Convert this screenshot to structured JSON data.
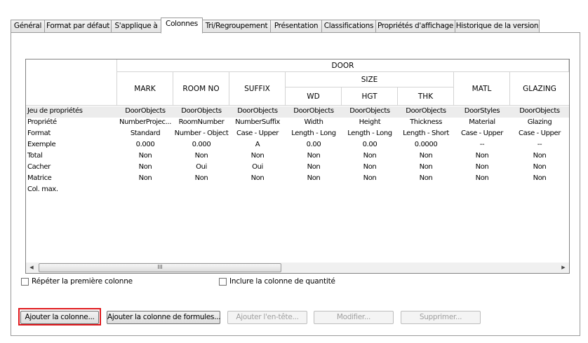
{
  "tabs": [
    {
      "label": "Général"
    },
    {
      "label": "Format par défaut"
    },
    {
      "label": "S'applique à"
    },
    {
      "label": "Colonnes"
    },
    {
      "label": "Tri/Regroupement"
    },
    {
      "label": "Présentation"
    },
    {
      "label": "Classifications"
    },
    {
      "label": "Propriétés d'affichage"
    },
    {
      "label": "Historique de la version"
    }
  ],
  "active_tab": "Colonnes",
  "grid": {
    "group_header": "DOOR",
    "size_header": "SIZE",
    "columns": [
      "MARK",
      "ROOM NO",
      "SUFFIX",
      "WD",
      "HGT",
      "THK",
      "MATL",
      "GLAZING"
    ],
    "row_labels": [
      "Jeu de propriétés",
      "Propriété",
      "Format",
      "Exemple",
      "Total",
      "Cacher",
      "Matrice",
      "Col. max."
    ],
    "rows": [
      [
        "DoorObjects",
        "DoorObjects",
        "DoorObjects",
        "DoorObjects",
        "DoorObjects",
        "DoorObjects",
        "DoorStyles",
        "DoorObjects"
      ],
      [
        "NumberProjec...",
        "RoomNumber",
        "NumberSuffix",
        "Width",
        "Height",
        "Thickness",
        "Material",
        "Glazing"
      ],
      [
        "Standard",
        "Number - Object",
        "Case - Upper",
        "Length - Long",
        "Length - Long",
        "Length - Short",
        "Case - Upper",
        "Case - Upper"
      ],
      [
        "0.000",
        "0.000",
        "A",
        "0.00",
        "0.00",
        "0.0000",
        "--",
        "--"
      ],
      [
        "Non",
        "Non",
        "Non",
        "Non",
        "Non",
        "Non",
        "Non",
        "Non"
      ],
      [
        "Non",
        "Oui",
        "Oui",
        "Non",
        "Non",
        "Non",
        "Non",
        "Non"
      ],
      [
        "Non",
        "Non",
        "Non",
        "Non",
        "Non",
        "Non",
        "Non",
        "Non"
      ],
      [
        "",
        "",
        "",
        "",
        "",
        "",
        "",
        ""
      ]
    ]
  },
  "scrollbar": {
    "thumb_grip": "III",
    "left_arrow": "◀",
    "right_arrow": "▶"
  },
  "checkboxes": {
    "repeat_first": "Répéter la première colonne",
    "include_qty": "Inclure la colonne de quantité"
  },
  "buttons": {
    "add_column": "Ajouter la colonne...",
    "add_formula": "Ajouter la colonne de formules...",
    "add_header": "Ajouter l'en-tête...",
    "modify": "Modifier...",
    "delete": "Supprimer..."
  },
  "colors": {
    "highlight": "#e0181c"
  }
}
